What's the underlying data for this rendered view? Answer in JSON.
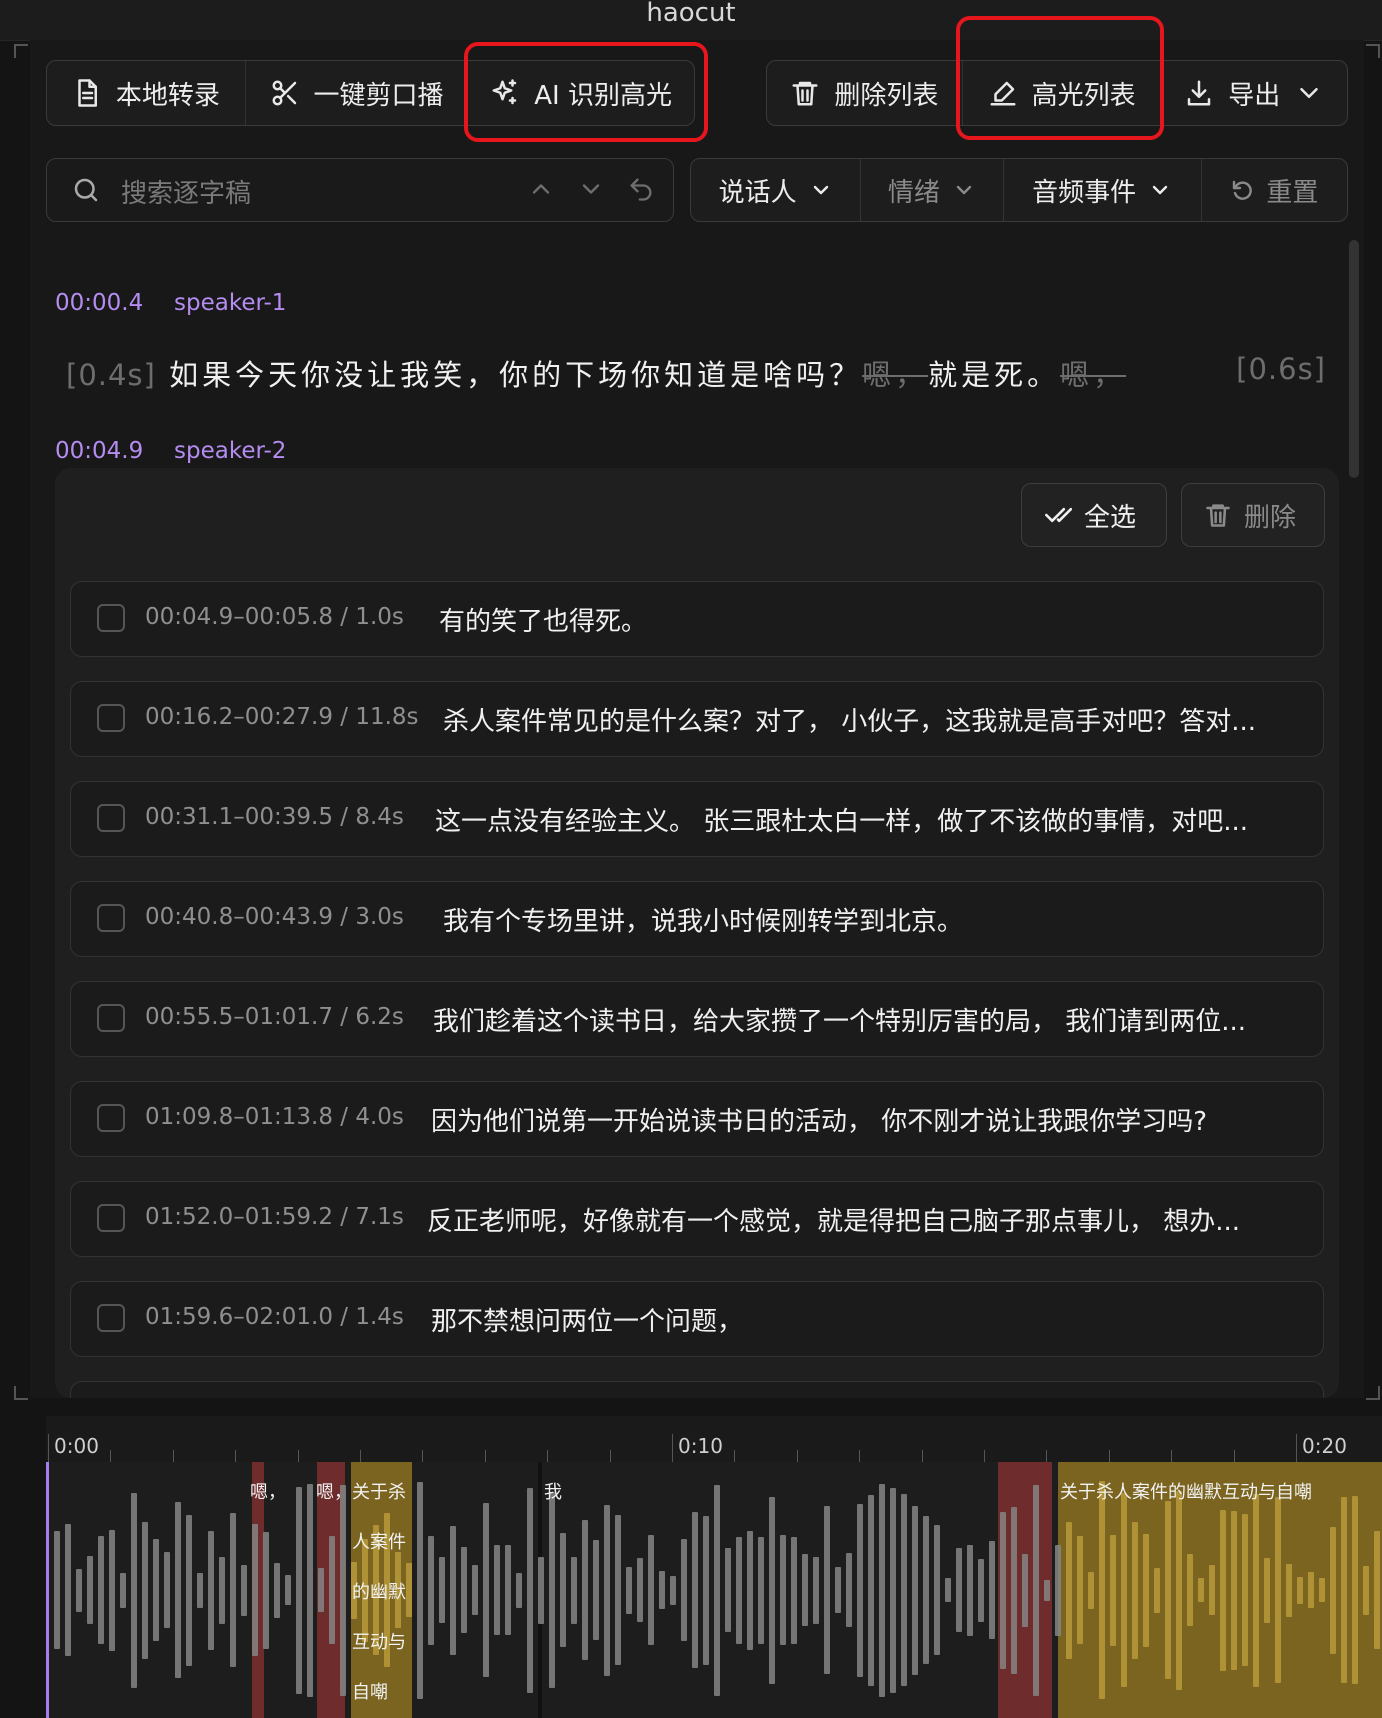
{
  "window": {
    "title": "haocut"
  },
  "toolbar": {
    "left_group": [
      {
        "label": "本地转录",
        "icon": "document-icon"
      },
      {
        "label": "一键剪口播",
        "icon": "scissors-icon"
      },
      {
        "label": "AI 识别高光",
        "icon": "sparkle-icon"
      }
    ],
    "right_group": [
      {
        "label": "删除列表",
        "icon": "trash-icon"
      },
      {
        "label": "高光列表",
        "icon": "highlighter-icon"
      },
      {
        "label": "导出",
        "icon": "download-icon"
      }
    ]
  },
  "search": {
    "placeholder": "搜索逐字稿"
  },
  "filters": {
    "speaker": "说话人",
    "emotion": "情绪",
    "audio_event": "音频事件",
    "reset": "重置"
  },
  "transcript": {
    "segments": [
      {
        "time": "00:00.4",
        "speaker": "speaker-1",
        "lead_gap": "[0.4s]",
        "text_a": "如果今天你没让我笑，你的下场你知道是啥吗？",
        "filler_a": "嗯，",
        "text_b": "就是死。",
        "filler_b": "嗯，",
        "tail_gap": "[0.6s]"
      },
      {
        "time": "00:04.9",
        "speaker": "speaker-2"
      }
    ]
  },
  "highlight_panel": {
    "select_all": "全选",
    "delete": "删除",
    "items": [
      {
        "range": "00:04.9–00:05.8 / 1.0s",
        "text": "有的笑了也得死。"
      },
      {
        "range": "00:16.2–00:27.9 / 11.8s",
        "text": "杀人案件常见的是什么案？对了， 小伙子，这我就是高手对吧？答对..."
      },
      {
        "range": "00:31.1–00:39.5 / 8.4s",
        "text": "这一点没有经验主义。 张三跟杜太白一样，做了不该做的事情，对吧..."
      },
      {
        "range": "00:40.8–00:43.9 / 3.0s",
        "text": "我有个专场里讲，说我小时候刚转学到北京。"
      },
      {
        "range": "00:55.5–01:01.7 / 6.2s",
        "text": "我们趁着这个读书日，给大家攒了一个特别厉害的局， 我们请到两位..."
      },
      {
        "range": "01:09.8–01:13.8 / 4.0s",
        "text": "因为他们说第一开始说读书日的活动， 你不刚才说让我跟你学习吗?"
      },
      {
        "range": "01:52.0–01:59.2 / 7.1s",
        "text": "反正老师呢，好像就有一个感觉，就是得把自己脑子那点事儿， 想办..."
      },
      {
        "range": "01:59.6–02:01.0 / 1.4s",
        "text": "那不禁想问两位一个问题，"
      }
    ]
  },
  "timeline": {
    "ticks": [
      "0:00",
      "0:10",
      "0:20"
    ],
    "labels": {
      "filler1": "嗯，",
      "filler2": "嗯，",
      "hl1_lines": [
        "关于杀",
        "人案件",
        "的幽默",
        "互动与",
        "自嘲"
      ],
      "word": "我",
      "hl2": "关于杀人案件的幽默互动与自嘲"
    },
    "colors": {
      "filler": "#6e2c2c",
      "highlight": "#7a6420",
      "playhead": "#a57ef0"
    }
  }
}
